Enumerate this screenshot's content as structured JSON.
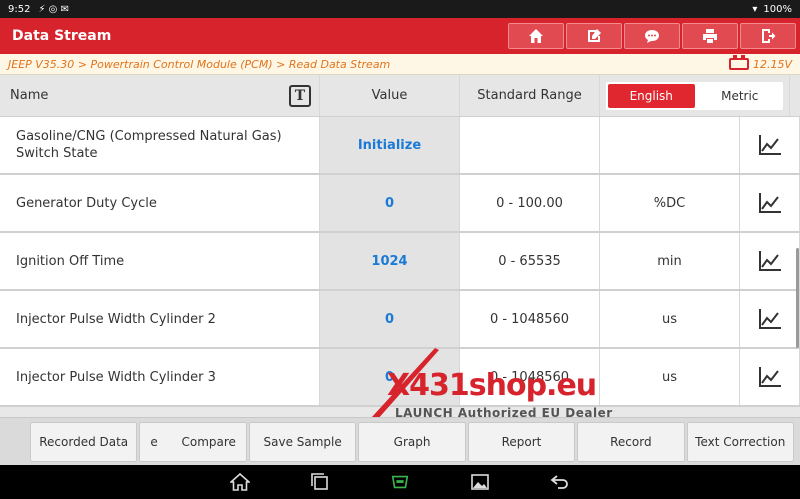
{
  "status": {
    "time": "9:52",
    "battery": "100%"
  },
  "header": {
    "title": "Data Stream",
    "tools": [
      "home-icon",
      "edit-icon",
      "message-icon",
      "print-icon",
      "exit-icon"
    ]
  },
  "breadcrumb": "JEEP V35.30 > Powertrain Control Module (PCM) > Read Data Stream",
  "voltage": "12.15V",
  "table": {
    "headers": {
      "name": "Name",
      "value": "Value",
      "range": "Standard Range"
    },
    "unit_toggle": {
      "options": [
        "English",
        "Metric"
      ],
      "selected": "English"
    },
    "rows": [
      {
        "name": "Gasoline/CNG (Compressed Natural Gas) Switch State",
        "value": "Initialize",
        "range": "",
        "unit": ""
      },
      {
        "name": "Generator Duty Cycle",
        "value": "0",
        "range": "0 - 100.00",
        "unit": "%DC"
      },
      {
        "name": "Ignition Off Time",
        "value": "1024",
        "range": "0 - 65535",
        "unit": "min"
      },
      {
        "name": "Injector Pulse Width Cylinder 2",
        "value": "0",
        "range": "0 - 1048560",
        "unit": "us"
      },
      {
        "name": "Injector Pulse Width Cylinder 3",
        "value": "0",
        "range": "0 - 1048560",
        "unit": "us"
      }
    ]
  },
  "footer": {
    "recorded_data": "Recorded Data",
    "compare_prefix": "e",
    "compare": "Compare",
    "save_sample": "Save Sample",
    "graph": "Graph",
    "report": "Report",
    "record": "Record",
    "text_correction": "Text Correction"
  },
  "watermark": {
    "brand": "X431shop.eu",
    "tagline": "LAUNCH Authorized EU Dealer"
  },
  "colors": {
    "accent": "#d6232c",
    "value_blue": "#1a7ad6",
    "breadcrumb_orange": "#e0741b"
  }
}
